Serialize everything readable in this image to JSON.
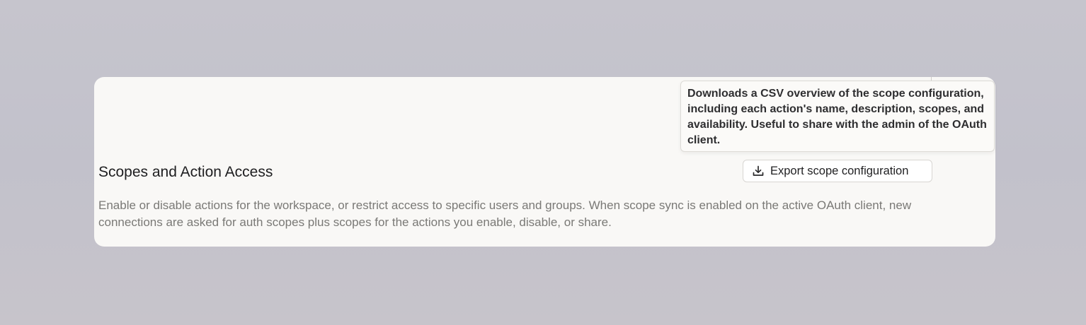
{
  "section": {
    "title": "Scopes and Action Access",
    "description": "Enable or disable actions for the workspace, or restrict access to specific users and groups. When scope sync is enabled on the active OAuth client, new connections are asked for auth scopes plus scopes for the actions you enable, disable, or share."
  },
  "export_button": {
    "label": "Export scope configuration",
    "icon": "download-icon"
  },
  "tooltip": {
    "text": "Downloads a CSV overview of the scope configuration, including each action's name, description, scopes, and availability. Useful to share with the admin of the OAuth client."
  }
}
